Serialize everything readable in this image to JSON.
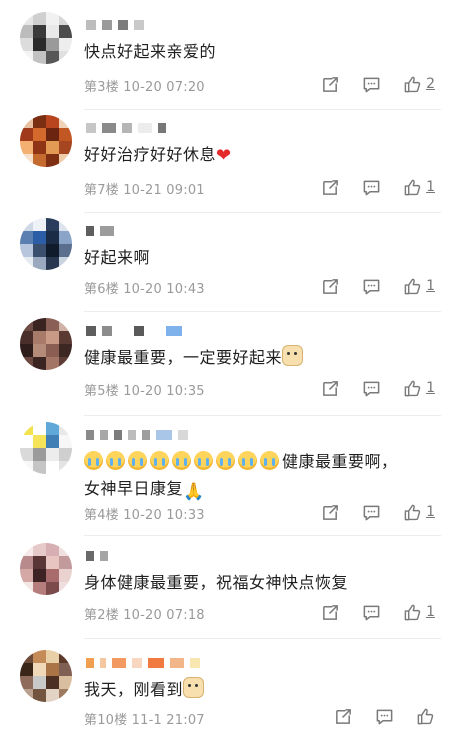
{
  "comments": [
    {
      "content": "快点好起来亲爱的",
      "meta": "第3楼 10-20 07:20",
      "likes": "2",
      "emoji": []
    },
    {
      "content": "好好治疗好好休息",
      "meta": "第7楼 10-21 09:01",
      "likes": "1",
      "emoji": [
        "heart"
      ]
    },
    {
      "content": "好起来啊",
      "meta": "第6楼 10-20 10:43",
      "likes": "1",
      "emoji": []
    },
    {
      "content": "健康最重要，一定要好起来",
      "meta": "第5楼 10-20 10:35",
      "likes": "1",
      "emoji": [
        "dog"
      ]
    },
    {
      "content_line2": "女神早日康复",
      "content": "健康最重要啊，",
      "meta": "第4楼 10-20 10:33",
      "likes": "1",
      "emoji": [
        "cry",
        "cry",
        "cry",
        "cry",
        "cry",
        "cry",
        "cry",
        "cry",
        "cry"
      ]
    },
    {
      "content": "身体健康最重要，祝福女神快点恢复",
      "meta": "第2楼 10-20 07:18",
      "likes": "1",
      "emoji": []
    },
    {
      "content": "我天，刚看到",
      "meta": "第10楼 11-1 21:07",
      "likes": "",
      "emoji": [
        "dog"
      ]
    }
  ],
  "icons": {
    "repost": "repost-icon",
    "comment": "comment-icon",
    "like": "like-icon",
    "heart": "red-heart-emoji",
    "cry": "crying-face-emoji",
    "dog": "dog-emoji",
    "pray": "praying-hands-emoji"
  }
}
